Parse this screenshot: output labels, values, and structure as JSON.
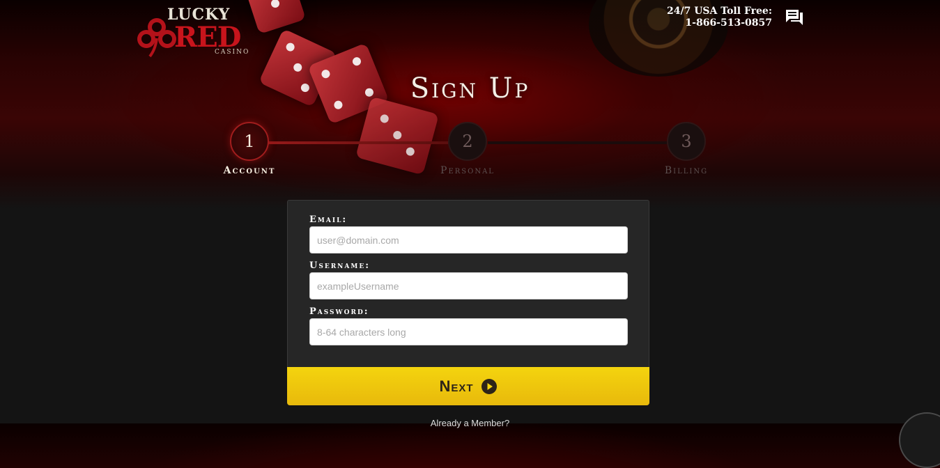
{
  "logo": {
    "line1": "LUCKY",
    "line2": "RED",
    "line3": "CASINO",
    "icon": "clover-logo-icon",
    "brand_color": "#c8141c"
  },
  "header": {
    "toll_label": "24/7 USA Toll Free:",
    "phone": "1-866-513-0857",
    "chat_icon": "chat-icon"
  },
  "page_title": "Sign Up",
  "steps": [
    {
      "number": "1",
      "label": "Account",
      "active": true
    },
    {
      "number": "2",
      "label": "Personal",
      "active": false
    },
    {
      "number": "3",
      "label": "Billing",
      "active": false
    }
  ],
  "form": {
    "email": {
      "label": "Email:",
      "value": "",
      "placeholder": "user@domain.com"
    },
    "username": {
      "label": "Username:",
      "value": "",
      "placeholder": "exampleUsername"
    },
    "password": {
      "label": "Password:",
      "value": "",
      "placeholder": "8-64 characters long"
    }
  },
  "next_button": {
    "label": "Next",
    "icon": "play-circle-icon",
    "color": "#f4d40e"
  },
  "footer": {
    "member_text": "Already a Member?"
  },
  "colors": {
    "accent_red": "#a11d1d",
    "button_yellow": "#f4d40e",
    "panel": "#262626"
  }
}
